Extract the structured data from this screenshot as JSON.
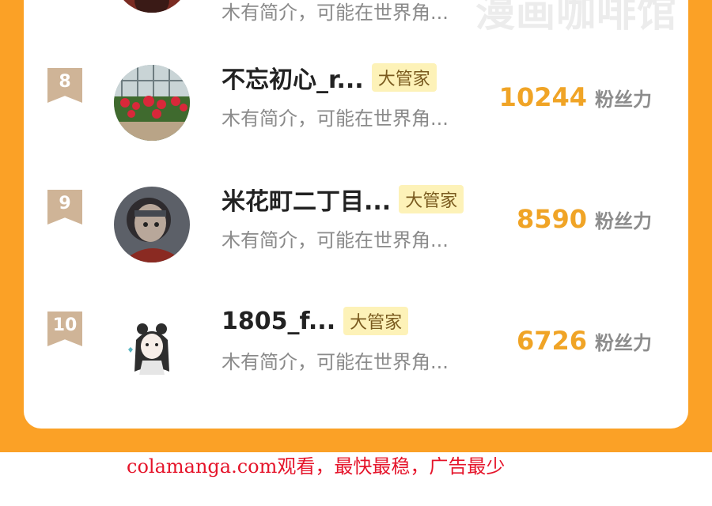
{
  "watermark": "漫画咖啡馆",
  "top_partial_intro": "木有简介，可能在世界角...",
  "rows": [
    {
      "rank": "8",
      "name": "不忘初心_r...",
      "badge": "大管家",
      "intro": "木有简介，可能在世界角...",
      "fans": "10244",
      "fans_unit": "粉丝力",
      "avatar_icon": "garden-photo-avatar"
    },
    {
      "rank": "9",
      "name": "米花町二丁目...",
      "badge": "大管家",
      "intro": "木有简介，可能在世界角...",
      "fans": "8590",
      "fans_unit": "粉丝力",
      "avatar_icon": "masked-character-avatar"
    },
    {
      "rank": "10",
      "name": "1805_f...",
      "badge": "大管家",
      "intro": "木有简介，可能在世界角...",
      "fans": "6726",
      "fans_unit": "粉丝力",
      "avatar_icon": "cartoon-girl-avatar"
    }
  ],
  "footer": "colamanga.com观看，最快最稳，广告最少",
  "colors": {
    "orange_frame": "#fba126",
    "fans_number": "#f0a426",
    "rank_flag": "#cfb497",
    "badge_bg": "#fdf2b8",
    "footer_red": "#e5142a"
  }
}
